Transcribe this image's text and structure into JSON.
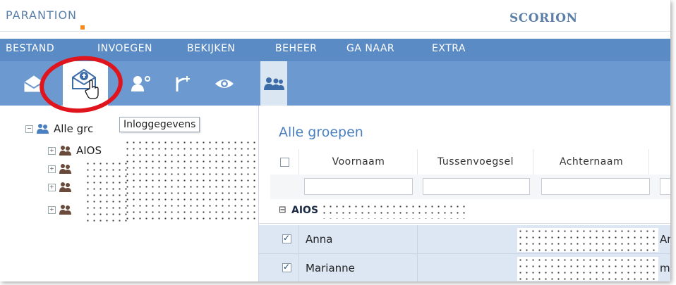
{
  "brand": {
    "logo": "PARANTION",
    "app_name": "SCORION"
  },
  "menu": [
    "BESTAND",
    "INVOEGEN",
    "BEKIJKEN",
    "BEHEER",
    "GA NAAR",
    "EXTRA"
  ],
  "toolbar": {
    "icons": [
      "envelope-open-icon",
      "envelope-upload-icon",
      "user-location-icon",
      "branch-add-icon",
      "eye-icon",
      "group-icon"
    ]
  },
  "tooltip": "Inloggegevens",
  "tree": {
    "root_label": "Alle groepen",
    "root_visible": "Alle grc",
    "children": [
      {
        "label": "AIOS"
      },
      {
        "label": ""
      },
      {
        "label": ""
      },
      {
        "label": ""
      }
    ]
  },
  "panel": {
    "title": "Alle groepen",
    "columns": [
      "Voornaam",
      "Tussenvoegsel",
      "Achternaam"
    ],
    "group_label": "AIOS",
    "rows": [
      {
        "voornaam": "Anna",
        "tail": "An",
        "checked": true
      },
      {
        "voornaam": "Marianne",
        "tail": "mf",
        "checked": true
      }
    ]
  },
  "colors": {
    "menu": "#5b8bc4",
    "toolbar": "#6b99d0",
    "accent": "#4a7fc0",
    "highlight": "#e0141c",
    "logo_dot": "#f28c1e"
  }
}
